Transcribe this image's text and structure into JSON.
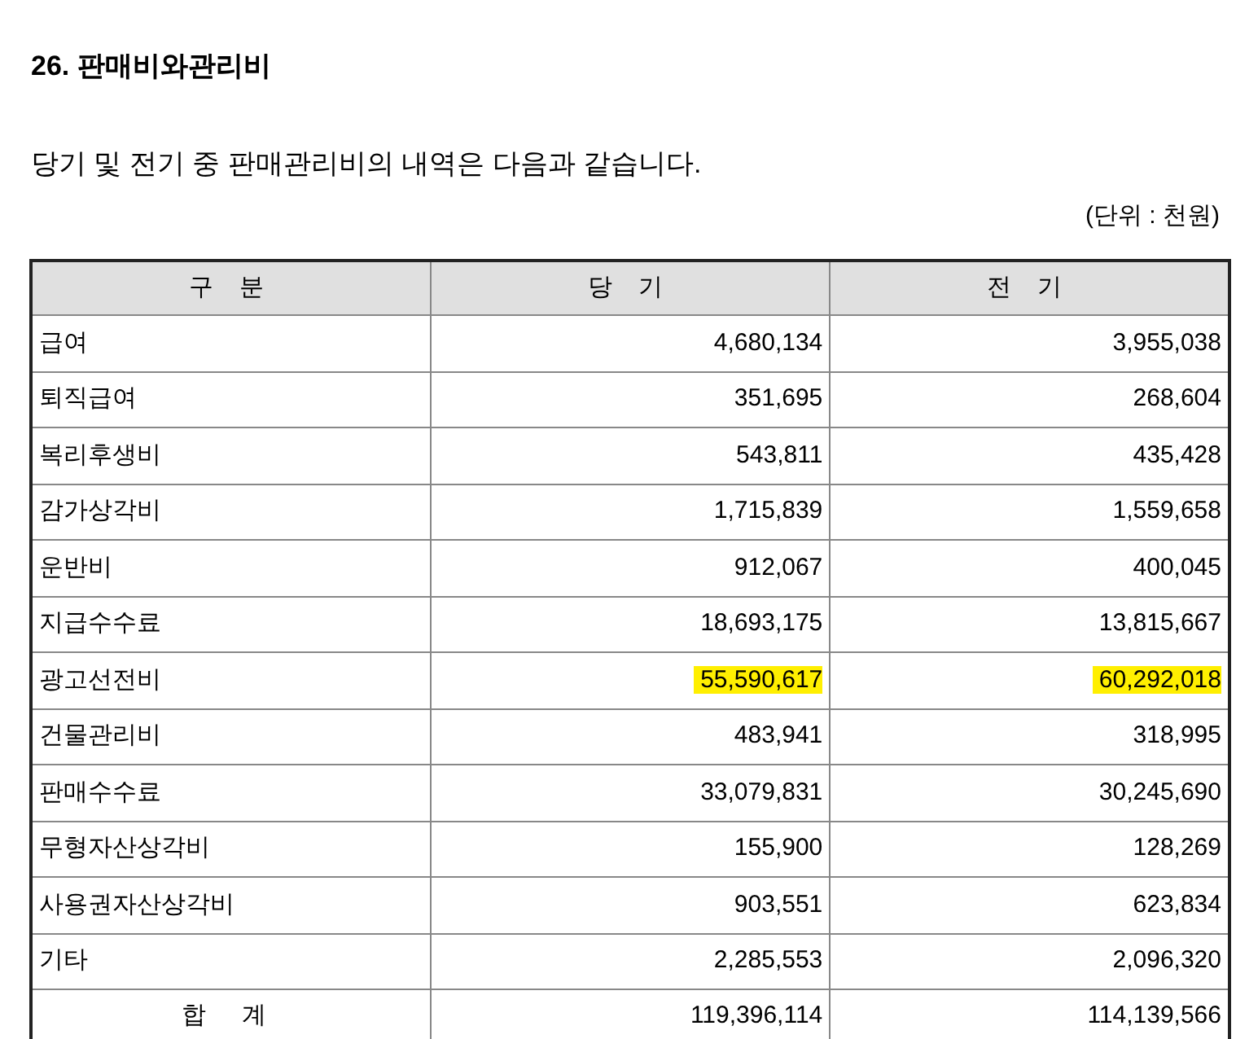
{
  "section_title": "26. 판매비와관리비",
  "intro": "당기 및 전기 중 판매관리비의 내역은 다음과 같습니다.",
  "unit": "(단위 : 천원)",
  "table": {
    "columns": [
      "구 분",
      "당 기",
      "전 기"
    ],
    "rows": [
      {
        "kind": "item",
        "label": "급여",
        "current": {
          "text": "4,680,134",
          "highlighted": false
        },
        "prior": {
          "text": "3,955,038",
          "highlighted": false
        }
      },
      {
        "kind": "item",
        "label": "퇴직급여",
        "current": {
          "text": "351,695",
          "highlighted": false
        },
        "prior": {
          "text": "268,604",
          "highlighted": false
        }
      },
      {
        "kind": "item",
        "label": "복리후생비",
        "current": {
          "text": "543,811",
          "highlighted": false
        },
        "prior": {
          "text": "435,428",
          "highlighted": false
        }
      },
      {
        "kind": "item",
        "label": "감가상각비",
        "current": {
          "text": "1,715,839",
          "highlighted": false
        },
        "prior": {
          "text": "1,559,658",
          "highlighted": false
        }
      },
      {
        "kind": "item",
        "label": "운반비",
        "current": {
          "text": "912,067",
          "highlighted": false
        },
        "prior": {
          "text": "400,045",
          "highlighted": false
        }
      },
      {
        "kind": "item",
        "label": "지급수수료",
        "current": {
          "text": "18,693,175",
          "highlighted": false
        },
        "prior": {
          "text": "13,815,667",
          "highlighted": false
        }
      },
      {
        "kind": "item",
        "label": "광고선전비",
        "current": {
          "text": "55,590,617",
          "highlighted": true
        },
        "prior": {
          "text": "60,292,018",
          "highlighted": true
        }
      },
      {
        "kind": "item",
        "label": "건물관리비",
        "current": {
          "text": "483,941",
          "highlighted": false
        },
        "prior": {
          "text": "318,995",
          "highlighted": false
        }
      },
      {
        "kind": "item",
        "label": "판매수수료",
        "current": {
          "text": "33,079,831",
          "highlighted": false
        },
        "prior": {
          "text": "30,245,690",
          "highlighted": false
        }
      },
      {
        "kind": "item",
        "label": "무형자산상각비",
        "current": {
          "text": "155,900",
          "highlighted": false
        },
        "prior": {
          "text": "128,269",
          "highlighted": false
        }
      },
      {
        "kind": "item",
        "label": "사용권자산상각비",
        "current": {
          "text": "903,551",
          "highlighted": false
        },
        "prior": {
          "text": "623,834",
          "highlighted": false
        }
      },
      {
        "kind": "item",
        "label": "기타",
        "current": {
          "text": "2,285,553",
          "highlighted": false
        },
        "prior": {
          "text": "2,096,320",
          "highlighted": false
        }
      },
      {
        "kind": "total",
        "label": "합 계",
        "current": {
          "text": "119,396,114",
          "highlighted": false
        },
        "prior": {
          "text": "114,139,566",
          "highlighted": false
        }
      }
    ]
  }
}
